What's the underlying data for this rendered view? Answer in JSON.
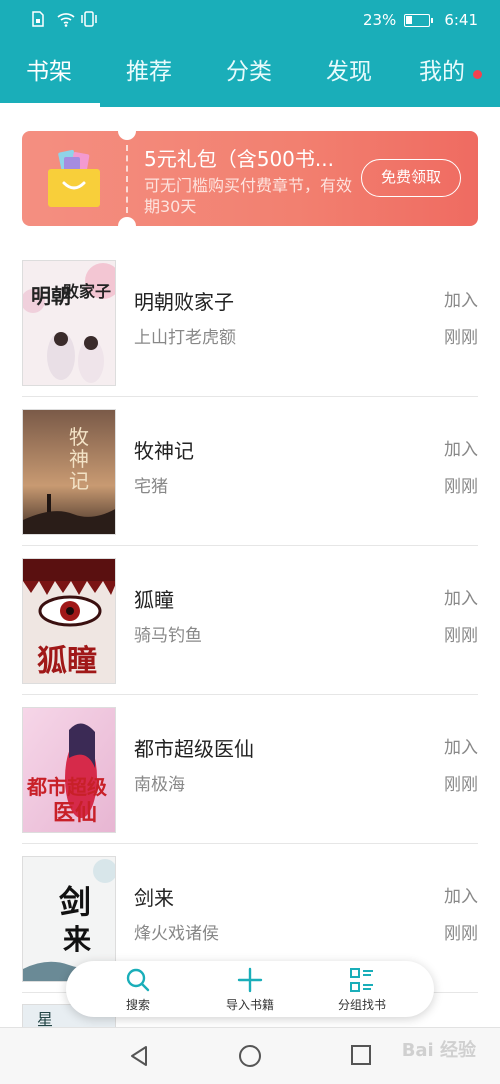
{
  "status": {
    "battery": "23%",
    "time": "6:41"
  },
  "tabs": [
    {
      "label": "书架",
      "active": true
    },
    {
      "label": "推荐",
      "active": false
    },
    {
      "label": "分类",
      "active": false
    },
    {
      "label": "发现",
      "active": false
    },
    {
      "label": "我的",
      "active": false,
      "badge": true
    }
  ],
  "banner": {
    "title": "5元礼包（含500书...",
    "desc": "可无门槛购买付费章节，有效期30天",
    "button": "免费领取"
  },
  "books": [
    {
      "title": "明朝败家子",
      "author": "上山打老虎额",
      "action": "加入",
      "time": "刚刚"
    },
    {
      "title": "牧神记",
      "author": "宅猪",
      "action": "加入",
      "time": "刚刚"
    },
    {
      "title": "狐瞳",
      "author": "骑马钓鱼",
      "action": "加入",
      "time": "刚刚"
    },
    {
      "title": "都市超级医仙",
      "author": "南极海",
      "action": "加入",
      "time": "刚刚"
    },
    {
      "title": "剑来",
      "author": "烽火戏诸侯",
      "action": "加入",
      "time": "刚刚"
    }
  ],
  "toolbar": {
    "search": "搜索",
    "import": "导入书籍",
    "group": "分组找书"
  },
  "colors": {
    "header": "#1aaeb9",
    "banner": "#f28070",
    "accent": "#1aaeb9"
  },
  "watermark": "Bai 经验"
}
